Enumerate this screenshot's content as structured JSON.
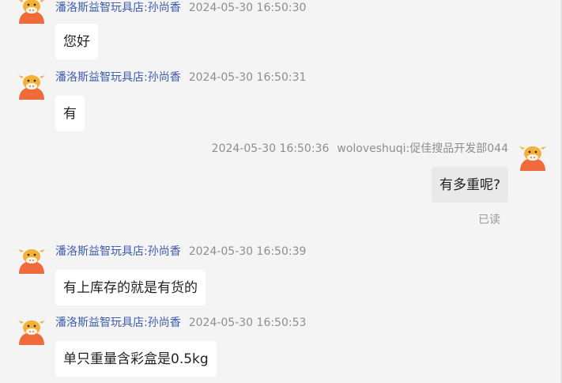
{
  "messages": [
    {
      "sender": "潘洛斯益智玩具店:孙尚香",
      "time": "2024-05-30 16:50:30",
      "text": "您好"
    },
    {
      "sender": "潘洛斯益智玩具店:孙尚香",
      "time": "2024-05-30 16:50:31",
      "text": "有"
    },
    {
      "sender": "woloveshuqi:促佳搜品开发部044",
      "time": "2024-05-30 16:50:36",
      "text": "有多重呢?",
      "status": "已读"
    },
    {
      "sender": "潘洛斯益智玩具店:孙尚香",
      "time": "2024-05-30 16:50:39",
      "text": "有上库存的就是有货的"
    },
    {
      "sender": "潘洛斯益智玩具店:孙尚香",
      "time": "2024-05-30 16:50:53",
      "text": "单只重量含彩盒是0.5kg"
    }
  ],
  "avatars": {
    "icon": "cartoon-cow-avatar",
    "colors": {
      "face": "#f2b23a",
      "body": "#f06b3c",
      "muzzle": "#fff4e6"
    }
  }
}
